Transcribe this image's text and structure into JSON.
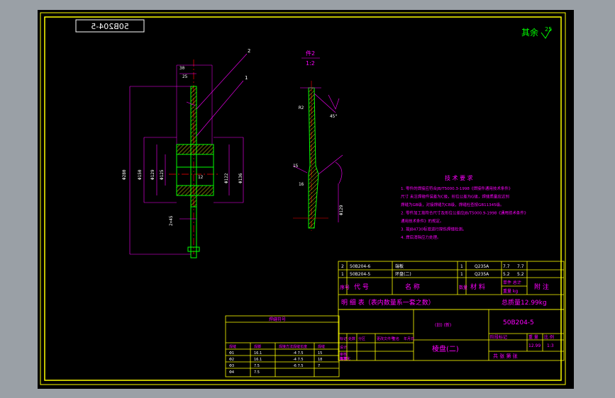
{
  "sheet": {
    "drawing_no_mirror": "50B204-5",
    "roughness_label": "其余",
    "roughness_value": "25"
  },
  "views": {
    "callout_1": "1",
    "callout_2": "2",
    "section_title": "件2",
    "section_scale": "1:2",
    "dims": {
      "d_top": "30",
      "d_25": "25",
      "r_left": "Φ280",
      "d_150": "Φ150",
      "d_129": "Φ129",
      "d_125": "Φ125",
      "d_122": "Φ122",
      "d_136": "Φ136",
      "d_12": "12",
      "d_wall": "2×45",
      "s_45": "45°",
      "s_r": "R2",
      "s_15": "15",
      "s_16": "16",
      "s_phi": "Φ129"
    }
  },
  "tech_req": {
    "title": "技 术 要 求",
    "lines": [
      "1. 零件的焊接应符合JB/T5000.3-1998《焊接件通用技术条件》",
      "   尺寸 未注焊接件误差为C级，形位公差为G级，焊缝质量应达到",
      "   焊缝为GB级，对接焊缝为CB级，焊缝检查按GB11345级。",
      "2. 零件加工按符合尺寸及形位公差应JB/T5000.9-1998《通用技术条件》",
      "   通用技术条件》的规定。",
      "3. 按JB4730标准进行探伤焊缝检测。",
      "4. 焊后消除应力处理。"
    ]
  },
  "parts_table": {
    "rows": [
      {
        "no": "2",
        "code": "50B204-6",
        "name": "端板",
        "qty": "1",
        "material": "Q235A",
        "w1": "7.7",
        "w2": "7.7"
      },
      {
        "no": "1",
        "code": "50B204-5",
        "name": "环盘(二)",
        "qty": "1",
        "material": "Q235A",
        "w1": "5.2",
        "w2": "5.2"
      }
    ],
    "header": {
      "no": "序号",
      "code": "代 号",
      "name": "名 称",
      "qty": "数量",
      "material": "材 料",
      "weight": "单件 总计",
      "weight_unit": "重量 kg",
      "note": "附 注"
    },
    "footer_left": "明 细 表（表内数量系一套之数）",
    "footer_right": "总质量12.99kg"
  },
  "title_block": {
    "drawing_no": "50B204-5",
    "name": "棱盘(二)",
    "stamp": "(旧) (新)",
    "stage_label": "阶段标记",
    "weight_label": "重 量",
    "scale_label": "比 例",
    "weight_value": "12.99",
    "scale_value": "1:3",
    "sheet_label": "共 张 第 张",
    "roles": [
      "标记",
      "处数",
      "分区",
      "更改文件号",
      "签名",
      "年月日"
    ],
    "sign_rows": [
      "设计",
      "审核",
      "工艺",
      "标准化",
      "批准"
    ]
  },
  "weld_table": {
    "title": "焊缝符号",
    "header": [
      "焊缝",
      "焊脚",
      "焊接方法",
      "焊缝长度",
      "焊缝"
    ],
    "rows": [
      [
        "Φ1",
        "16.1",
        "",
        "-4 7.5",
        "15"
      ],
      [
        "Φ2",
        "16.1",
        "",
        "-4 7.5",
        "18"
      ],
      [
        "Φ3",
        "7.5",
        "",
        "-6 7.5",
        "7"
      ],
      [
        "Φ4",
        "7.5",
        "",
        "",
        ""
      ]
    ]
  },
  "colors": {
    "frame": "#ffff00",
    "outline": "#00ff00",
    "dimension": "#ff00ff",
    "hatch": "#ffff00",
    "text": "#ffffff",
    "center": "#ff0000"
  }
}
